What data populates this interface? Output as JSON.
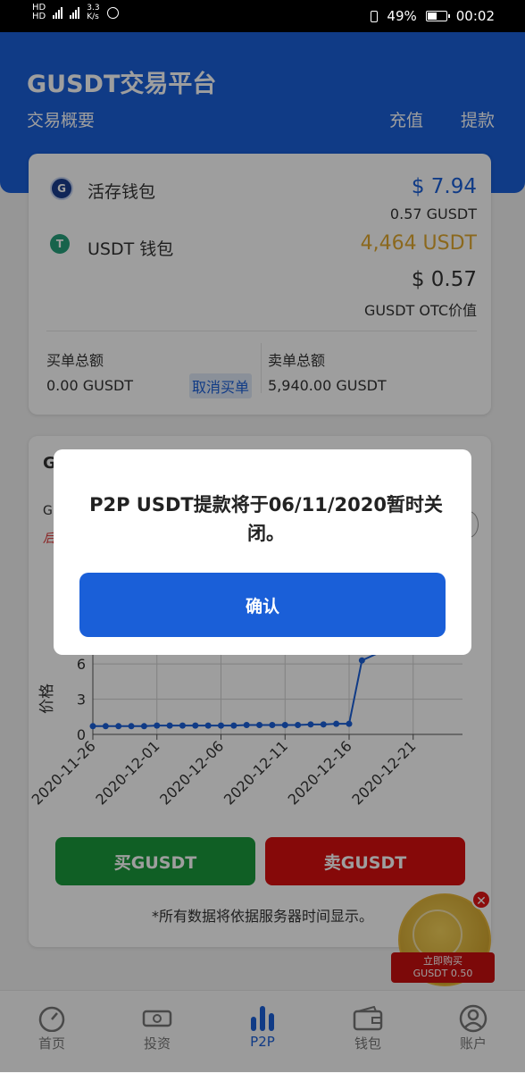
{
  "status_bar": {
    "network_speed_value": "3.3",
    "network_speed_unit": "K/s",
    "battery": "49%",
    "time": "00:02"
  },
  "header": {
    "title": "GUSDT交易平台",
    "subtitle": "交易概要",
    "deposit_label": "充值",
    "withdraw_label": "提款"
  },
  "wallets": [
    {
      "name": "活存钱包",
      "amount_usd": "$ 7.94",
      "amount_token": "0.57 GUSDT",
      "icon": "gusdt-logo-icon"
    },
    {
      "name": "USDT 钱包",
      "amount_token": "4,464 USDT",
      "icon": "tether-icon"
    }
  ],
  "otc": {
    "value": "$ 0.57",
    "label": "GUSDT OTC价值"
  },
  "orders": {
    "buy_total_label": "买单总额",
    "buy_total_value": "0.00 GUSDT",
    "cancel_buy_label": "取消买单",
    "sell_total_label": "卖单总额",
    "sell_total_value": "5,940.00 GUSDT"
  },
  "chart_card": {
    "title_initial": "G",
    "sub_initial": "G",
    "alert_initial": "后"
  },
  "chart_data": {
    "type": "line",
    "ylabel": "价格",
    "yticks": [
      0,
      3,
      6
    ],
    "ylim": [
      0,
      7
    ],
    "x_tick_labels": [
      "2020-11-26",
      "2020-12-01",
      "2020-12-06",
      "2020-12-11",
      "2020-12-16",
      "2020-12-21"
    ],
    "x": [
      "2020-11-26",
      "2020-11-27",
      "2020-11-28",
      "2020-11-29",
      "2020-11-30",
      "2020-12-01",
      "2020-12-02",
      "2020-12-03",
      "2020-12-04",
      "2020-12-05",
      "2020-12-06",
      "2020-12-07",
      "2020-12-08",
      "2020-12-09",
      "2020-12-10",
      "2020-12-11",
      "2020-12-12",
      "2020-12-13",
      "2020-12-14",
      "2020-12-15",
      "2020-12-16",
      "2020-12-17"
    ],
    "values": [
      0.7,
      0.7,
      0.7,
      0.7,
      0.7,
      0.75,
      0.75,
      0.75,
      0.75,
      0.75,
      0.75,
      0.75,
      0.8,
      0.8,
      0.8,
      0.8,
      0.8,
      0.85,
      0.85,
      0.9,
      0.9,
      6.3
    ],
    "grid": true
  },
  "actions": {
    "buy_label": "买GUSDT",
    "sell_label": "卖GUSDT"
  },
  "note": "*所有数据将依据服务器时间显示。",
  "promo": {
    "line1": "立即购买",
    "line2": "GUSDT 0.50"
  },
  "tabs": [
    {
      "label": "首页",
      "icon": "gauge-icon",
      "active": false
    },
    {
      "label": "投资",
      "icon": "cash-icon",
      "active": false
    },
    {
      "label": "P2P",
      "icon": "bar-chart-icon",
      "active": true
    },
    {
      "label": "钱包",
      "icon": "wallet-icon",
      "active": false
    },
    {
      "label": "账户",
      "icon": "user-icon",
      "active": false
    }
  ],
  "dialog": {
    "message": "P2P USDT提款将于06/11/2020暂时关闭。",
    "confirm_label": "确认"
  },
  "colors": {
    "primary": "#1a5fd8",
    "buy": "#1b9a3c",
    "sell": "#d80f0f",
    "gold": "#e0a830"
  }
}
